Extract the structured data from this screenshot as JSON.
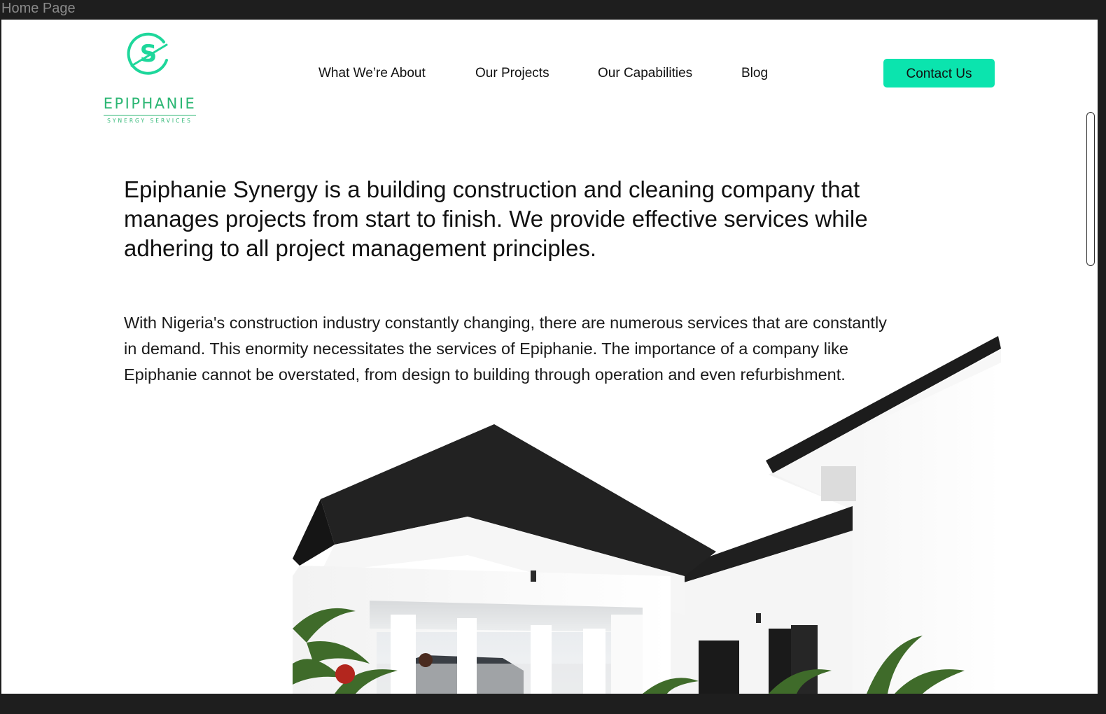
{
  "window": {
    "frame_title": "Home Page"
  },
  "brand": {
    "name": "EPIPHANIE",
    "tagline": "SYNERGY SERVICES",
    "mark_letter": "S",
    "color": "#2bb673"
  },
  "nav": {
    "items": [
      {
        "label": "What We’re About"
      },
      {
        "label": "Our Projects"
      },
      {
        "label": "Our Capabilities"
      },
      {
        "label": "Blog"
      }
    ],
    "contact_label": "Contact Us",
    "contact_color": "#0be4ae"
  },
  "hero": {
    "headline": "Epiphanie Synergy is a building construction and cleaning company that manages projects from start to finish. We provide effective services while adhering to all project management principles.",
    "body": "With Nigeria's construction industry constantly changing, there are  numerous services that are constantly in demand. This enormity necessitates the services of Epiphanie. The importance of a company like Epiphanie cannot be overstated, from design to building through operation and even refurbishment."
  },
  "icons": {
    "logo": "epiphanie-s-logo-icon",
    "hero_image": "white-house-photo"
  }
}
